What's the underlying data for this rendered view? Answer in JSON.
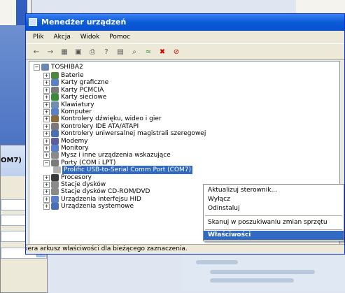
{
  "device_manager": {
    "title": "Menedżer urządzeń",
    "menu": [
      "Plik",
      "Akcja",
      "Widok",
      "Pomoc"
    ],
    "toolbar_icons": [
      "back-icon",
      "forward-icon",
      "view-icon",
      "properties-icon",
      "print-icon",
      "help-icon",
      "show-icon",
      "scan-icon",
      "update-icon",
      "uninstall-icon",
      "disable-icon"
    ],
    "tree": {
      "root": "TOSHIBA2",
      "items": [
        "Baterie",
        "Karty graficzne",
        "Karty PCMCIA",
        "Karty sieciowe",
        "Klawiatury",
        "Komputer",
        "Kontrolery dźwięku, wideo i gier",
        "Kontrolery IDE ATA/ATAPI",
        "Kontrolery uniwersalnej magistrali szeregowej",
        "Modemy",
        "Monitory",
        "Mysz i inne urządzenia wskazujące",
        "Porty (COM i LPT)",
        "Prolific USB-to-Serial Comm Port (COM7)",
        "Procesory",
        "Stacje dysków",
        "Stacje dysków CD-ROM/DVD",
        "Urządzenia interfejsu HID",
        "Urządzenia systemowe"
      ]
    },
    "status": "iera arkusz właściwości dla bieżącego zaznaczenia."
  },
  "context_menu": {
    "items": [
      "Aktualizuj sterownik...",
      "Wyłącz",
      "Odinstaluj",
      "Skanuj w poszukiwaniu zmian sprzętu",
      "Właściwości"
    ]
  },
  "properties_dialog": {
    "title": "OM7)"
  },
  "colors": {
    "title_blue": "#0a5bd8",
    "selection": "#316ac5"
  }
}
